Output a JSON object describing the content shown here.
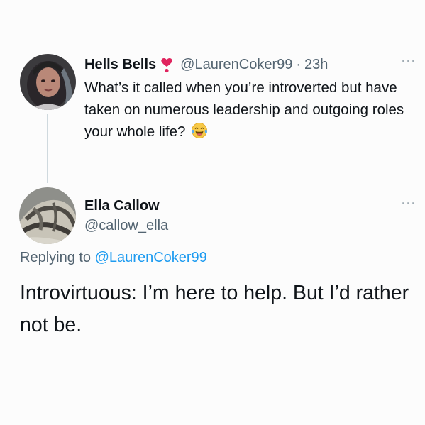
{
  "tweet": {
    "author_name": "Hells Bells",
    "badge_icon": "heart-exclamation-icon",
    "handle": "@LaurenCoker99",
    "separator": "·",
    "time": "23h",
    "more": "···",
    "text": "What’s it called when you’re introverted but have taken on numerous leadership and outgoing roles your whole life?",
    "emoji_icon": "tears-of-joy-emoji"
  },
  "reply": {
    "author_name": "Ella Callow",
    "handle": "@callow_ella",
    "more": "···",
    "replying_prefix": "Replying to",
    "replying_mention": "@LaurenCoker99",
    "text": "Introvirtuous: I’m here to help. But I’d rather not be."
  },
  "colors": {
    "text": "#0f1419",
    "secondary": "#536471",
    "link": "#1d9bf0",
    "heart": "#e0245e",
    "thread_line": "#cfd9de",
    "background": "#fcfcfc"
  }
}
